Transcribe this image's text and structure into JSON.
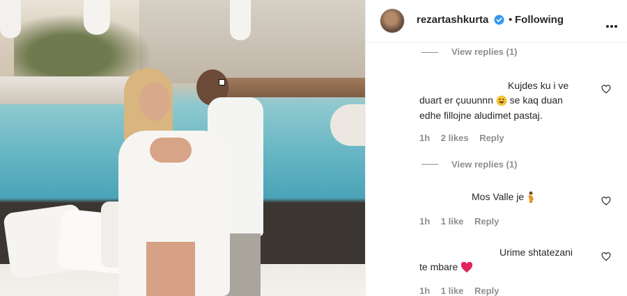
{
  "post": {
    "username": "rezartashkurta",
    "verified": true,
    "separator": "•",
    "follow_label": "Following"
  },
  "comments": [
    {
      "view_replies": "View replies (1)"
    },
    {
      "text_line1": "Kujdes ku i ve",
      "text_line2a": "duart er çuuunnn",
      "text_line2b": "se kaq duan",
      "text_line3": "edhe fillojne aludimet pastaj.",
      "time": "1h",
      "likes": "2 likes",
      "reply": "Reply",
      "view_replies": "View replies (1)",
      "emoji": "grinning-face-emoji"
    },
    {
      "text": "Mos Valle je",
      "time": "1h",
      "likes": "1 like",
      "reply": "Reply",
      "emoji": "pregnant-woman-emoji"
    },
    {
      "text_line1": "Urime shtatezani",
      "text_line2": "te mbare",
      "time": "1h",
      "likes": "1 like",
      "reply": "Reply",
      "emoji": "red-heart-emoji"
    }
  ],
  "colors": {
    "text": "#262626",
    "secondary": "#8e8e8e",
    "verified": "#3897f0",
    "heart_emoji": "#e0245e"
  }
}
